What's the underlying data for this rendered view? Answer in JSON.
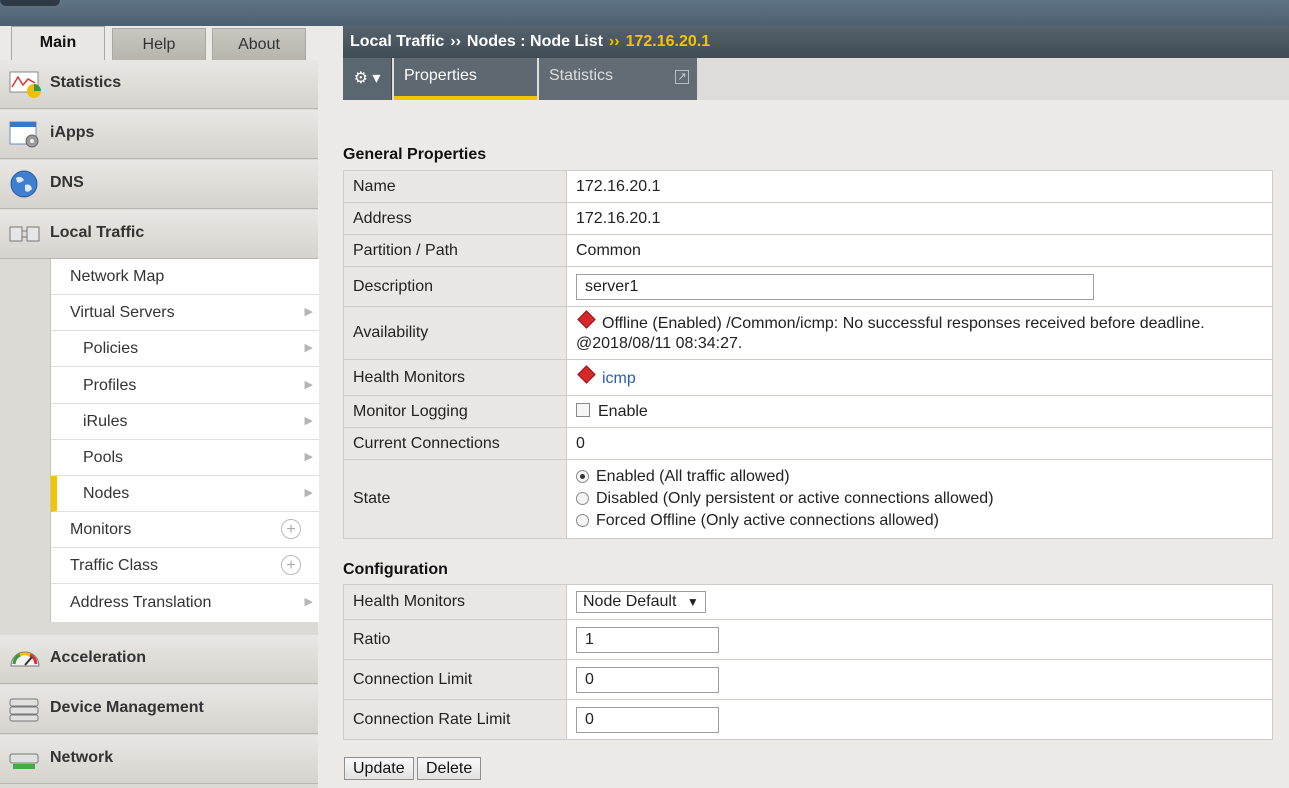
{
  "main_tabs": [
    "Main",
    "Help",
    "About"
  ],
  "sidebar": {
    "categories": [
      {
        "label": "Statistics",
        "icon": "statistics-chart-icon"
      },
      {
        "label": "iApps",
        "icon": "iapps-gear-icon"
      },
      {
        "label": "DNS",
        "icon": "globe-icon"
      },
      {
        "label": "Local Traffic",
        "icon": "local-traffic-icon"
      },
      {
        "label": "Acceleration",
        "icon": "speedometer-icon"
      },
      {
        "label": "Device Management",
        "icon": "server-stack-icon"
      },
      {
        "label": "Network",
        "icon": "network-switch-icon"
      }
    ],
    "local_traffic_items": [
      {
        "label": "Network Map"
      },
      {
        "label": "Virtual Servers"
      },
      {
        "label": "Policies"
      },
      {
        "label": "Profiles"
      },
      {
        "label": "iRules"
      },
      {
        "label": "Pools"
      },
      {
        "label": "Nodes"
      },
      {
        "label": "Monitors"
      },
      {
        "label": "Traffic Class"
      },
      {
        "label": "Address Translation"
      }
    ],
    "selected_item": "Nodes"
  },
  "breadcrumb": {
    "part1": "Local Traffic",
    "sep": "››",
    "part2": "Nodes : Node List",
    "current": "172.16.20.1"
  },
  "content_tabs": {
    "properties": "Properties",
    "statistics": "Statistics"
  },
  "general": {
    "title": "General Properties",
    "name_label": "Name",
    "name_value": "172.16.20.1",
    "address_label": "Address",
    "address_value": "172.16.20.1",
    "partition_label": "Partition / Path",
    "partition_value": "Common",
    "description_label": "Description",
    "description_value": "server1",
    "availability_label": "Availability",
    "availability_line1": "Offline (Enabled) /Common/icmp: No successful responses received before deadline.",
    "availability_line2": "@2018/08/11 08:34:27.",
    "health_label": "Health Monitors",
    "health_value": "icmp",
    "logging_label": "Monitor Logging",
    "logging_value": "Enable",
    "connections_label": "Current Connections",
    "connections_value": "0",
    "state_label": "State",
    "state_options": [
      "Enabled (All traffic allowed)",
      "Disabled (Only persistent or active connections allowed)",
      "Forced Offline (Only active connections allowed)"
    ],
    "state_selected": 0
  },
  "configuration": {
    "title": "Configuration",
    "health_label": "Health Monitors",
    "health_value": "Node Default",
    "ratio_label": "Ratio",
    "ratio_value": "1",
    "conn_limit_label": "Connection Limit",
    "conn_limit_value": "0",
    "rate_limit_label": "Connection Rate Limit",
    "rate_limit_value": "0"
  },
  "buttons": {
    "update": "Update",
    "delete": "Delete"
  },
  "colors": {
    "accent": "#f5c400",
    "offline": "#d4292a",
    "link": "#2a5db0"
  }
}
